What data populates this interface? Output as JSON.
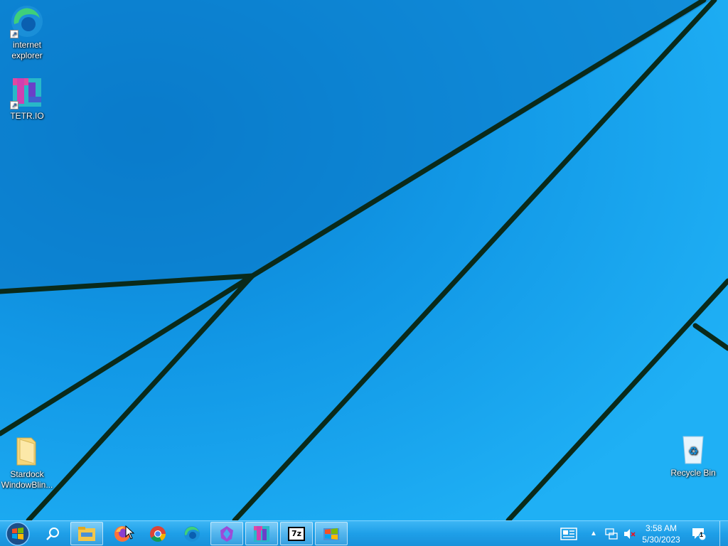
{
  "desktop": {
    "icons": [
      {
        "name": "internet-explorer-shortcut",
        "label": "internet explorer"
      },
      {
        "name": "tetrio-shortcut",
        "label": "TETR.IO"
      },
      {
        "name": "stardock-windowblinds-folder",
        "label": "Stardock WindowBlin..."
      },
      {
        "name": "recycle-bin",
        "label": "Recycle Bin"
      }
    ]
  },
  "taskbar": {
    "start_icon": "windows-start-icon",
    "search_icon": "search-icon",
    "pinned_apps": [
      {
        "name": "file-explorer",
        "icon": "folder-icon",
        "active": true
      },
      {
        "name": "firefox",
        "icon": "firefox-icon",
        "active": false
      },
      {
        "name": "chrome",
        "icon": "chrome-icon",
        "active": false
      },
      {
        "name": "edge",
        "icon": "edge-icon",
        "active": false
      },
      {
        "name": "app-purple",
        "icon": "purple-app-icon",
        "active": true
      },
      {
        "name": "tetrio",
        "icon": "tetrio-icon",
        "active": true
      },
      {
        "name": "7zip",
        "icon": "7zip-icon",
        "label": "7z",
        "active": true
      },
      {
        "name": "windows-explorer-alt",
        "icon": "windows-icon",
        "active": true
      }
    ],
    "tray": {
      "clock_time": "3:58 AM",
      "clock_date": "5/30/2023",
      "notification_count": "1"
    }
  },
  "colors": {
    "wallpaper": "#1a9ae6",
    "taskbar": "#1e9fe8",
    "lines": "#0a2a1a"
  }
}
